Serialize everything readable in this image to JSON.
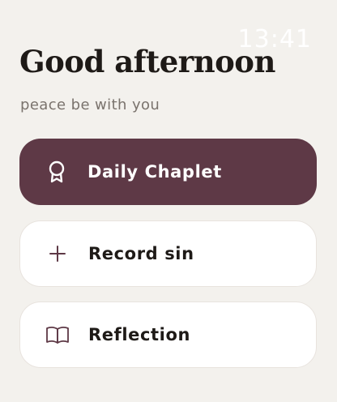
{
  "status_bar": {
    "time": "13:41"
  },
  "header": {
    "greeting": "Good afternoon",
    "subtitle": "peace be with you"
  },
  "actions": [
    {
      "label": "Daily Chaplet",
      "icon": "award-ribbon-icon",
      "style": "primary"
    },
    {
      "label": "Record sin",
      "icon": "plus-icon",
      "style": "secondary"
    },
    {
      "label": "Reflection",
      "icon": "open-book-icon",
      "style": "secondary"
    }
  ],
  "colors": {
    "background": "#f3f1ed",
    "primary": "#5e3946",
    "card": "#ffffff",
    "text": "#1e1a17",
    "muted": "#7a736d"
  }
}
